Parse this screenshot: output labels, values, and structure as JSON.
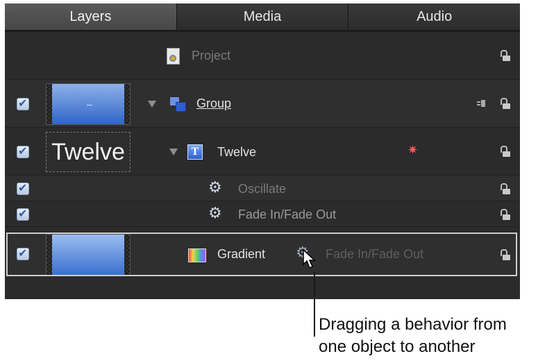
{
  "tabs": [
    {
      "label": "Layers",
      "active": true
    },
    {
      "label": "Media",
      "active": false
    },
    {
      "label": "Audio",
      "active": false
    }
  ],
  "rows": {
    "project": {
      "label": "Project"
    },
    "group": {
      "label": "Group",
      "checked": true
    },
    "twelve": {
      "label": "Twelve",
      "thumb_text": "Twelve",
      "checked": true
    },
    "oscillate": {
      "label": "Oscillate",
      "checked": true
    },
    "fade1": {
      "label": "Fade In/Fade Out",
      "checked": true
    },
    "gradient": {
      "label": "Gradient",
      "checked": true,
      "drag_label": "Fade In/Fade Out"
    }
  },
  "icons": {
    "project": "document-icon",
    "group": "group-icon",
    "text": "text-layer-icon",
    "gradient": "gradient-icon",
    "behavior": "gear-icon",
    "lock": "lock-icon",
    "visibility": "visibility-icon"
  },
  "callout": {
    "line1": "Dragging a behavior from",
    "line2": "one object to another"
  },
  "colors": {
    "panel_bg": "#2b2b2b",
    "active_tab": "#4f4f4f",
    "thumb_gradient_top": "#8fb0e8",
    "thumb_gradient_bottom": "#2f66c9"
  }
}
